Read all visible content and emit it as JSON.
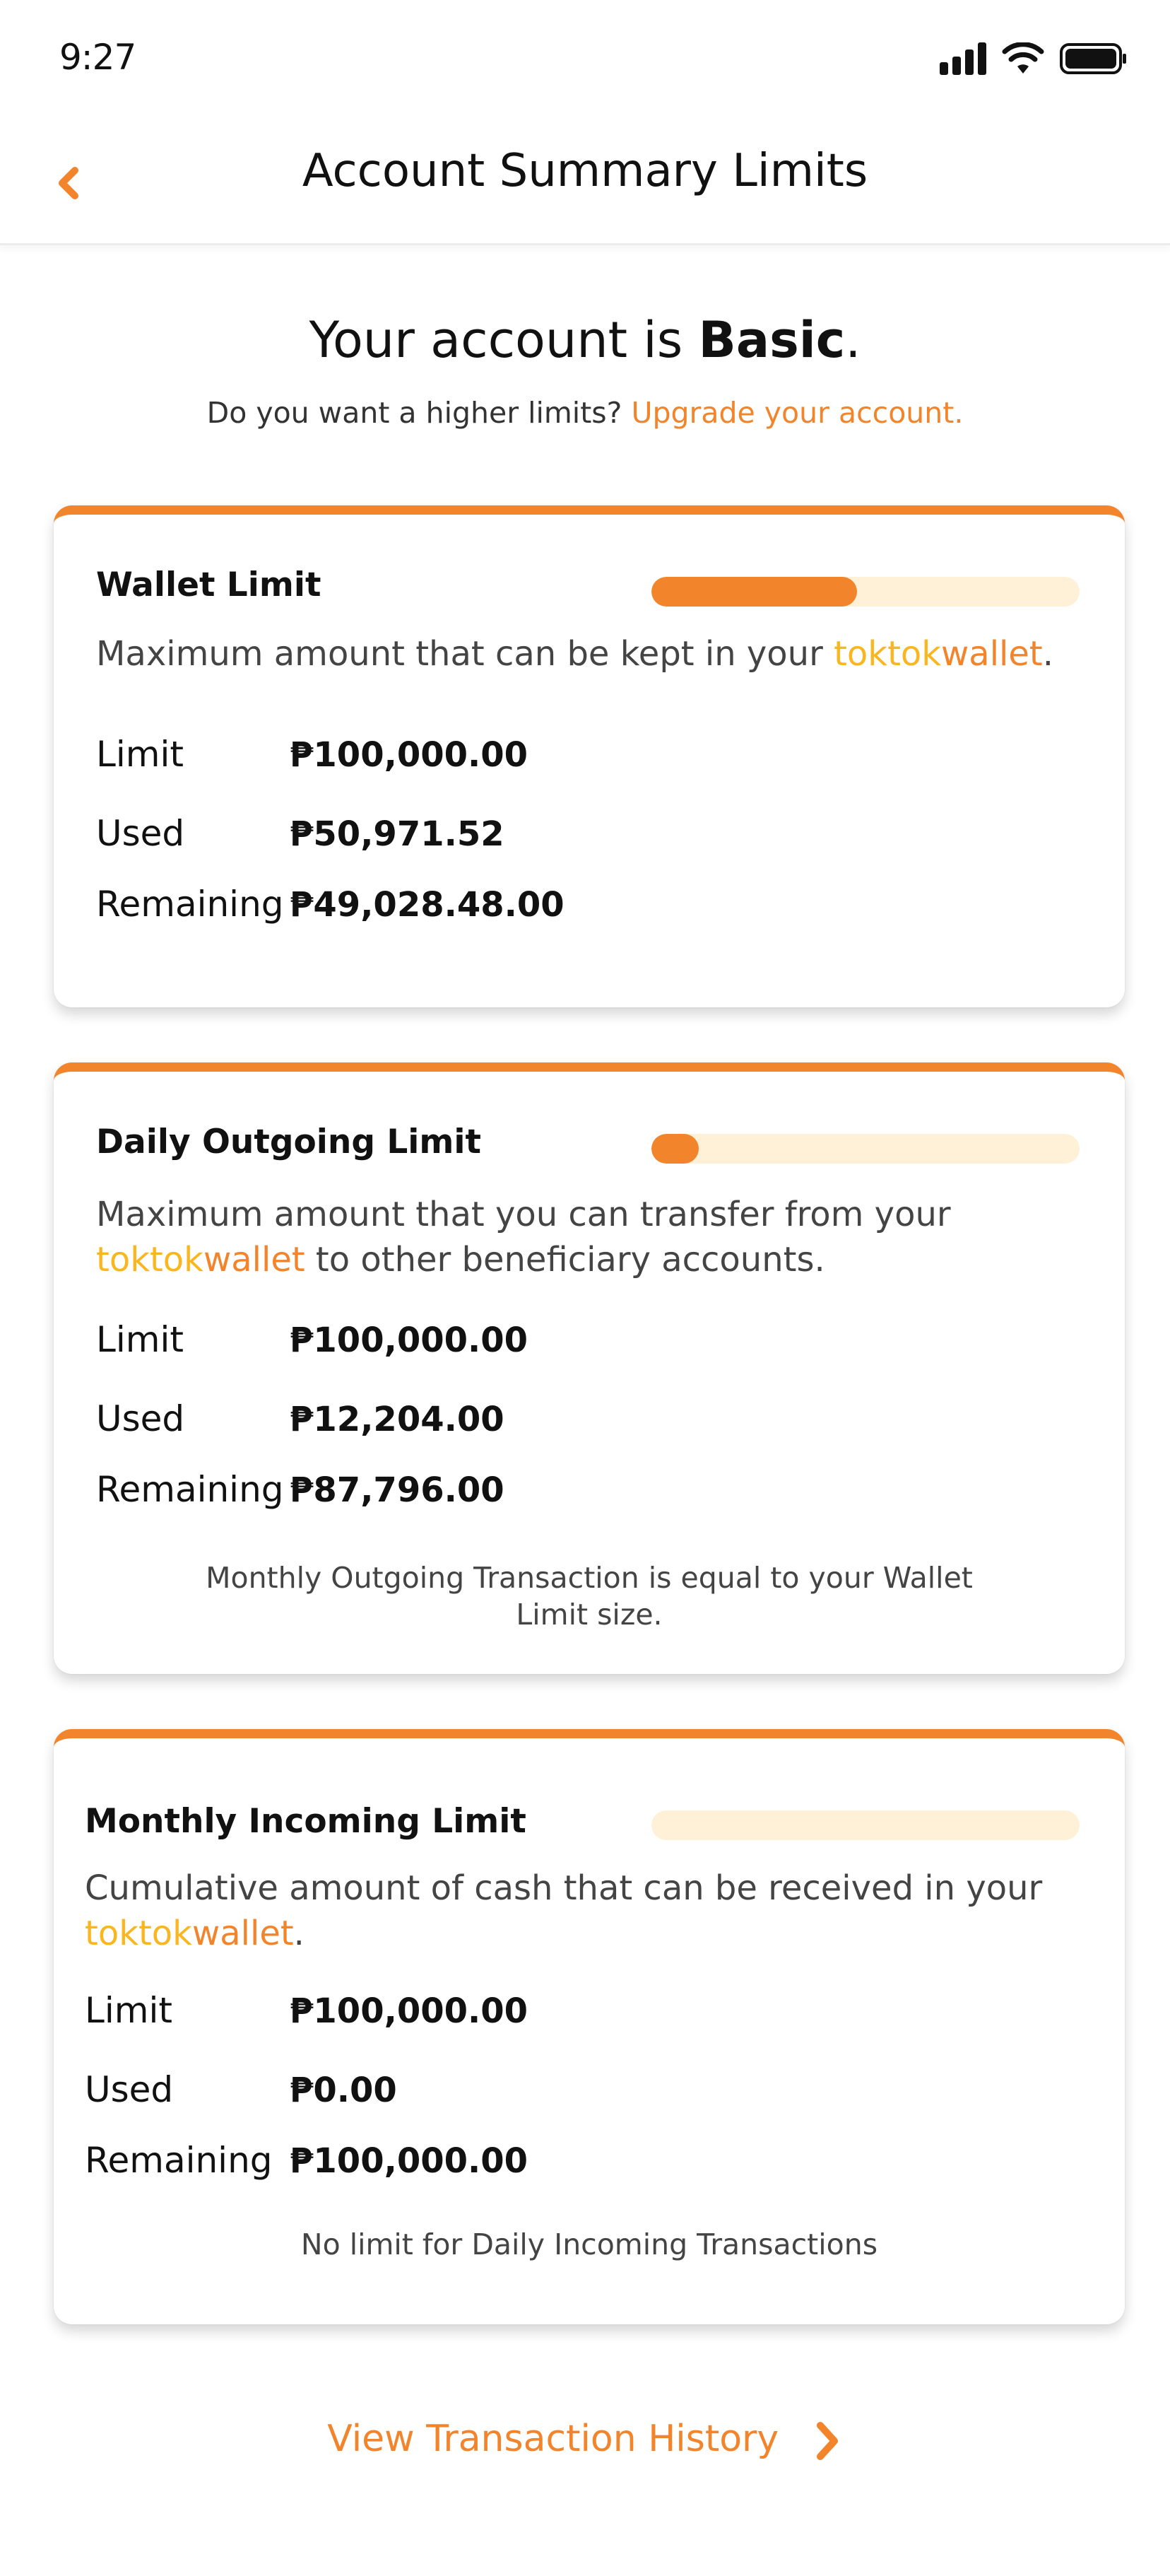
{
  "status_bar": {
    "time": "9:27",
    "icons": [
      "cellular-signal-icon",
      "wifi-icon",
      "battery-icon"
    ]
  },
  "header": {
    "title": "Account Summary Limits",
    "back_icon": "chevron-left-icon"
  },
  "account": {
    "prefix": "Your account is ",
    "level": "Basic",
    "suffix": ".",
    "prompt": "Do you want a higher limits? ",
    "upgrade_link": "Upgrade your account."
  },
  "brand": {
    "part1": "toktok",
    "part2": "wallet"
  },
  "labels": {
    "limit": "Limit",
    "used": "Used",
    "remaining": "Remaining"
  },
  "cards": [
    {
      "title": "Wallet Limit",
      "progress_fraction": 0.48,
      "desc_before": "Maximum amount that can be kept in your ",
      "desc_after": ".",
      "limit": "₱100,000.00",
      "used": "₱50,971.52",
      "remaining": "₱49,028.48.00",
      "note": ""
    },
    {
      "title": "Daily Outgoing Limit",
      "progress_fraction": 0.11,
      "desc_before": "Maximum amount that you can transfer from your",
      "desc_after": " to other beneficiary accounts.",
      "limit": "₱100,000.00",
      "used": "₱12,204.00",
      "remaining": "₱87,796.00",
      "note": "Monthly Outgoing Transaction is equal to your Wallet Limit size."
    },
    {
      "title": "Monthly Incoming Limit",
      "progress_fraction": 0.0,
      "desc_before": "Cumulative amount of cash that can be received in your",
      "desc_after": ".",
      "limit": "₱100,000.00",
      "used": "₱0.00",
      "remaining": "₱100,000.00",
      "note": "No limit for Daily Incoming Transactions"
    }
  ],
  "footer": {
    "history_link": "View Transaction History",
    "history_icon": "chevron-right-icon"
  },
  "colors": {
    "accent": "#F2852B",
    "brand_yellow": "#F9B61E",
    "progress_track": "#FEF1D8"
  }
}
